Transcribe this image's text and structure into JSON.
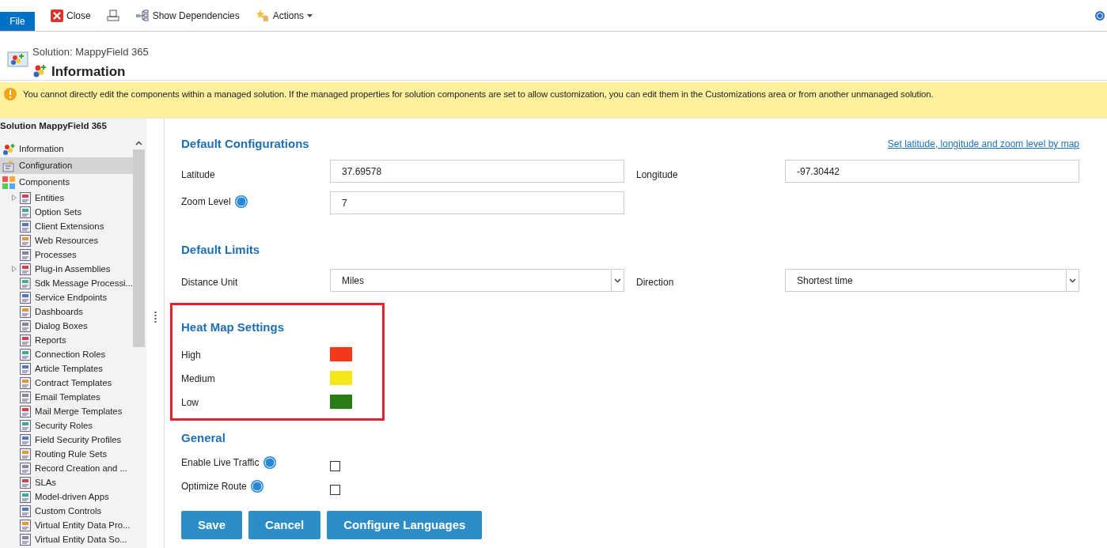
{
  "toolbar": {
    "file_tab": "File",
    "buttons": [
      {
        "kind": "close",
        "label": "Close"
      },
      {
        "kind": "print"
      },
      {
        "kind": "dependencies",
        "label": "Show Dependencies"
      },
      {
        "kind": "actions",
        "label": "Actions"
      }
    ]
  },
  "header": {
    "solution": "Solution: MappyField 365",
    "title": "Information"
  },
  "notice": "You cannot directly edit the components within a managed solution. If the managed properties for solution components are set to allow customization, you can edit them in the Customizations area or from another unmanaged solution.",
  "sidebar": {
    "title": "Solution MappyField 365",
    "items": [
      {
        "label": "Information",
        "selected": false,
        "kind": "info"
      },
      {
        "label": "Configuration",
        "selected": true,
        "kind": "config"
      },
      {
        "label": "Components",
        "selected": false,
        "kind": "components",
        "children": [
          {
            "label": "Entities",
            "selected": false,
            "kind": "expandable"
          },
          {
            "label": "Option Sets",
            "selected": false,
            "kind": "leaf"
          },
          {
            "label": "Client Extensions",
            "selected": false,
            "kind": "leaf"
          },
          {
            "label": "Web Resources",
            "selected": false,
            "kind": "leaf"
          },
          {
            "label": "Processes",
            "selected": false,
            "kind": "leaf"
          },
          {
            "label": "Plug-in Assemblies",
            "selected": false,
            "kind": "expandable"
          },
          {
            "label": "Sdk Message Processi...",
            "selected": false,
            "kind": "leaf"
          },
          {
            "label": "Service Endpoints",
            "selected": false,
            "kind": "leaf"
          },
          {
            "label": "Dashboards",
            "selected": false,
            "kind": "leaf"
          },
          {
            "label": "Dialog Boxes",
            "selected": false,
            "kind": "leaf"
          },
          {
            "label": "Reports",
            "selected": false,
            "kind": "leaf"
          },
          {
            "label": "Connection Roles",
            "selected": false,
            "kind": "leaf"
          },
          {
            "label": "Article Templates",
            "selected": false,
            "kind": "leaf"
          },
          {
            "label": "Contract Templates",
            "selected": false,
            "kind": "leaf"
          },
          {
            "label": "Email Templates",
            "selected": false,
            "kind": "leaf"
          },
          {
            "label": "Mail Merge Templates",
            "selected": false,
            "kind": "leaf"
          },
          {
            "label": "Security Roles",
            "selected": false,
            "kind": "leaf"
          },
          {
            "label": "Field Security Profiles",
            "selected": false,
            "kind": "leaf"
          },
          {
            "label": "Routing Rule Sets",
            "selected": false,
            "kind": "leaf"
          },
          {
            "label": "Record Creation and ...",
            "selected": false,
            "kind": "leaf"
          },
          {
            "label": "SLAs",
            "selected": false,
            "kind": "leaf"
          },
          {
            "label": "Model-driven Apps",
            "selected": false,
            "kind": "leaf"
          },
          {
            "label": "Custom Controls",
            "selected": false,
            "kind": "leaf"
          },
          {
            "label": "Virtual Entity Data Pro...",
            "selected": false,
            "kind": "leaf"
          },
          {
            "label": "Virtual Entity Data So...",
            "selected": false,
            "kind": "leaf"
          }
        ]
      }
    ]
  },
  "default_configurations": {
    "title": "Default Configurations",
    "map_link": "Set latitude, longitude and zoom level by map",
    "latitude": {
      "label": "Latitude",
      "value": "37.69578"
    },
    "longitude": {
      "label": "Longitude",
      "value": "-97.30442"
    },
    "zoom": {
      "label": "Zoom Level",
      "value": "7"
    }
  },
  "default_limits": {
    "title": "Default Limits",
    "distance_unit": {
      "label": "Distance Unit",
      "value": "Miles"
    },
    "direction": {
      "label": "Direction",
      "value": "Shortest time"
    }
  },
  "heat_map": {
    "title": "Heat Map Settings",
    "levels": [
      {
        "label": "High",
        "color": "#f4391b"
      },
      {
        "label": "Medium",
        "color": "#f4e81b"
      },
      {
        "label": "Low",
        "color": "#2a7d12"
      }
    ]
  },
  "general": {
    "title": "General",
    "options": [
      {
        "label": "Enable Live Traffic",
        "checked": false
      },
      {
        "label": "Optimize Route",
        "checked": false
      }
    ]
  },
  "actions": [
    "Save",
    "Cancel",
    "Configure Languages"
  ]
}
